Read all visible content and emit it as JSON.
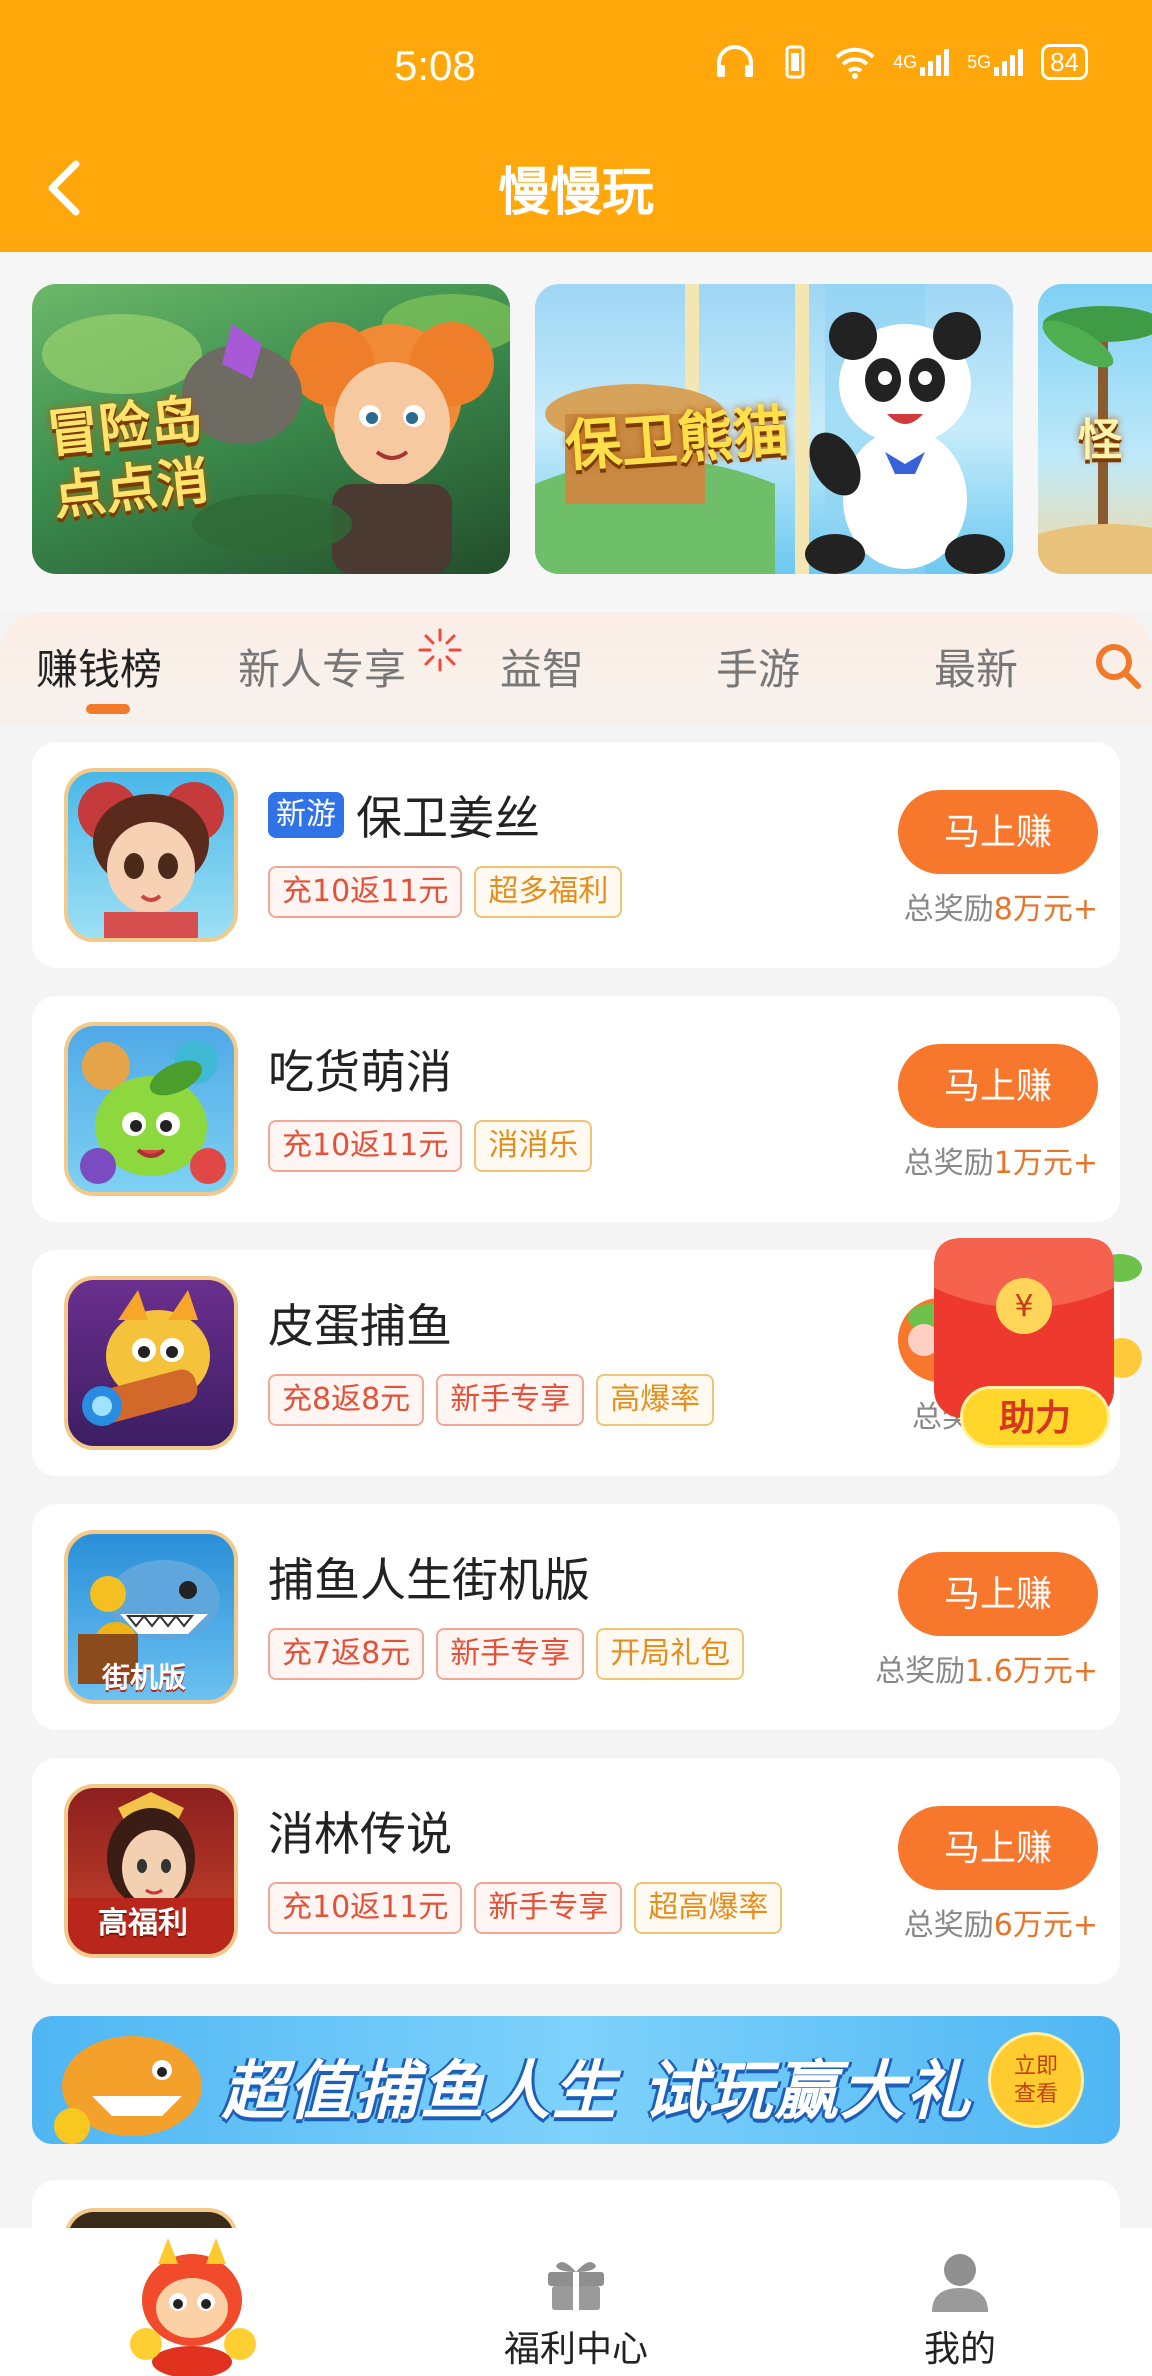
{
  "status_bar": {
    "time": "5:08",
    "network_5g": "5G",
    "network_4g": "4G",
    "battery": "84"
  },
  "header": {
    "title": "慢慢玩"
  },
  "banners": [
    {
      "label": "冒险岛点点消"
    },
    {
      "label": "保卫熊猫"
    },
    {
      "label": "怪"
    }
  ],
  "tabs": [
    "赚钱榜",
    "新人专享",
    "益智",
    "手游",
    "最新"
  ],
  "active_tab": "赚钱榜",
  "earn_label": "马上赚",
  "games": [
    {
      "name": "保卫姜丝",
      "badge": "新游",
      "tags": [
        {
          "text": "充10返11元",
          "style": "red"
        },
        {
          "text": "超多福利",
          "style": "orange"
        }
      ],
      "reward_prefix": "总奖励",
      "reward_amount": "8万元+"
    },
    {
      "name": "吃货萌消",
      "badge": "",
      "tags": [
        {
          "text": "充10返11元",
          "style": "red"
        },
        {
          "text": "消消乐",
          "style": "orange"
        }
      ],
      "reward_prefix": "总奖励",
      "reward_amount": "1万元+"
    },
    {
      "name": "皮蛋捕鱼",
      "badge": "",
      "tags": [
        {
          "text": "充8返8元",
          "style": "red"
        },
        {
          "text": "新手专享",
          "style": "red"
        },
        {
          "text": "高爆率",
          "style": "orange"
        }
      ],
      "reward_prefix": "总奖",
      "reward_amount": ""
    },
    {
      "name": "捕鱼人生街机版",
      "badge": "",
      "tags": [
        {
          "text": "充7返8元",
          "style": "red"
        },
        {
          "text": "新手专享",
          "style": "red"
        },
        {
          "text": "开局礼包",
          "style": "orange"
        }
      ],
      "reward_prefix": "总奖励",
      "reward_amount": "1.6万元+"
    },
    {
      "name": "消林传说",
      "badge": "",
      "tags": [
        {
          "text": "充10返11元",
          "style": "red"
        },
        {
          "text": "新手专享",
          "style": "red"
        },
        {
          "text": "超高爆率",
          "style": "orange"
        }
      ],
      "reward_prefix": "总奖励",
      "reward_amount": "6万元+"
    }
  ],
  "icon_captions": {
    "arcade": "街机版",
    "welfare": "高福利"
  },
  "promo": {
    "text": "超值捕鱼人生 试玩赢大礼",
    "button_line1": "立即",
    "button_line2": "查看"
  },
  "floating": {
    "label": "助力"
  },
  "bottom_nav": [
    {
      "label": ""
    },
    {
      "label": "福利中心"
    },
    {
      "label": "我的"
    }
  ],
  "colors": {
    "header_orange": "#ffa70b",
    "button_orange": "#f7772d",
    "accent_blue": "#2f73e6"
  }
}
